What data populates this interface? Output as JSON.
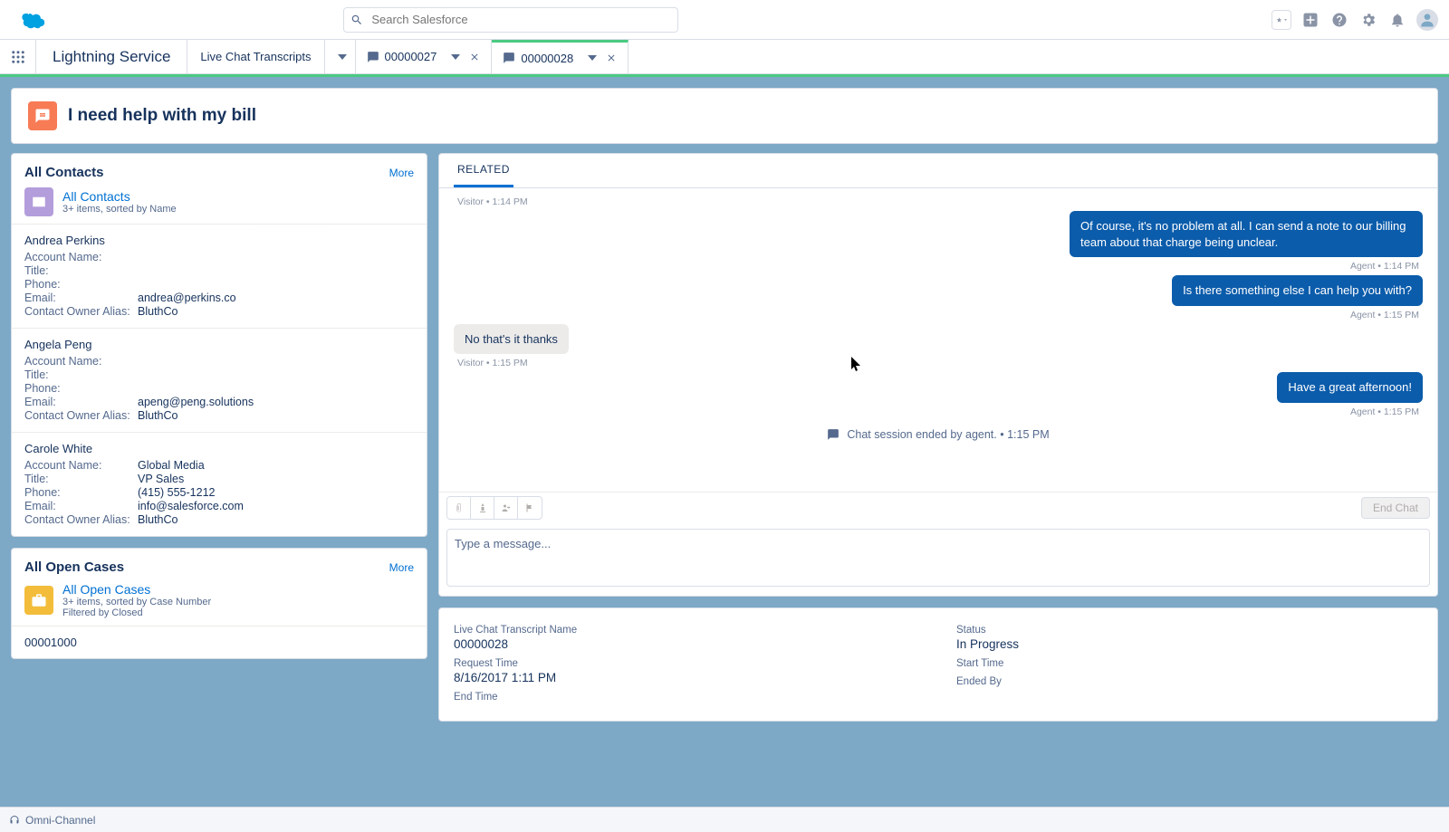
{
  "search": {
    "placeholder": "Search Salesforce"
  },
  "appName": "Lightning Service",
  "navItem": "Live Chat Transcripts",
  "tabs": [
    {
      "label": "00000027",
      "active": false
    },
    {
      "label": "00000028",
      "active": true
    }
  ],
  "pageTitle": "I need help with my bill",
  "contactsCard": {
    "title": "All Contacts",
    "more": "More",
    "subTitle": "All Contacts",
    "subLine": "3+ items, sorted by Name",
    "contacts": [
      {
        "name": "Andrea Perkins",
        "account": "",
        "title": "",
        "phone": "",
        "email": "andrea@perkins.co",
        "owner": "BluthCo"
      },
      {
        "name": "Angela Peng",
        "account": "",
        "title": "",
        "phone": "",
        "email": "apeng@peng.solutions",
        "owner": "BluthCo"
      },
      {
        "name": "Carole White",
        "account": "Global Media",
        "title": "VP Sales",
        "phone": "(415) 555-1212",
        "email": "info@salesforce.com",
        "owner": "BluthCo"
      }
    ],
    "labels": {
      "account": "Account Name:",
      "title": "Title:",
      "phone": "Phone:",
      "email": "Email:",
      "owner": "Contact Owner Alias:"
    }
  },
  "casesCard": {
    "title": "All Open Cases",
    "more": "More",
    "subTitle": "All Open Cases",
    "subLine1": "3+ items, sorted by Case Number",
    "subLine2": "Filtered by Closed",
    "rows": [
      "00001000"
    ]
  },
  "relatedTab": "RELATED",
  "chat": {
    "pre_meta": "Visitor • 1:14 PM",
    "messages": [
      {
        "who": "agent",
        "text": "Of course, it's no problem at all. I can send a note to our billing team about that charge being unclear.",
        "meta": "Agent • 1:14 PM"
      },
      {
        "who": "agent",
        "text": "Is there something else I can help you with?",
        "meta": "Agent • 1:15 PM"
      },
      {
        "who": "visitor",
        "text": "No that's it thanks",
        "meta": "Visitor • 1:15 PM"
      },
      {
        "who": "agent",
        "text": "Have a great afternoon!",
        "meta": "Agent • 1:15 PM"
      }
    ],
    "sessionEnd": "Chat session ended by agent. • 1:15 PM",
    "endBtn": "End Chat",
    "inputPlaceholder": "Type a message..."
  },
  "details": {
    "left": [
      {
        "label": "Live Chat Transcript Name",
        "value": "00000028"
      },
      {
        "label": "Request Time",
        "value": "8/16/2017 1:11 PM"
      },
      {
        "label": "End Time",
        "value": ""
      }
    ],
    "right": [
      {
        "label": "Status",
        "value": "In Progress"
      },
      {
        "label": "Start Time",
        "value": ""
      },
      {
        "label": "Ended By",
        "value": ""
      }
    ]
  },
  "utilityBar": "Omni-Channel"
}
